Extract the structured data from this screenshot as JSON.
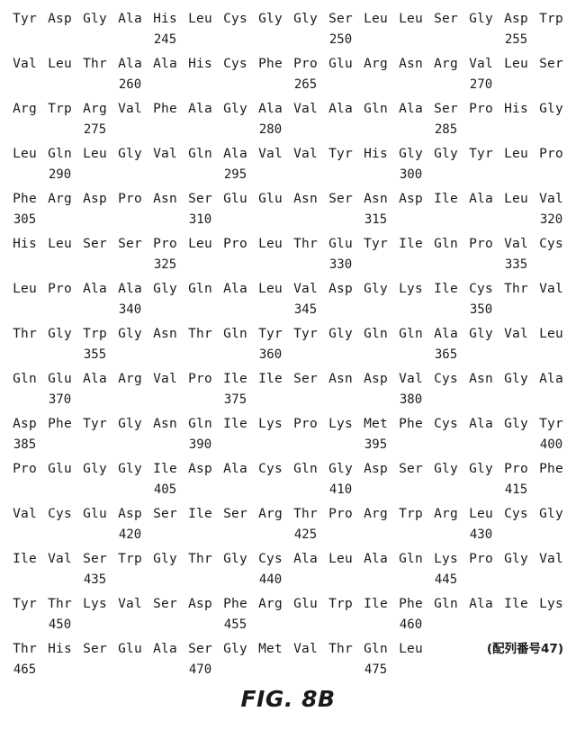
{
  "document": {
    "figure_caption": "FIG. 8B",
    "seq_id_note": "(配列番号47)"
  },
  "sequence": {
    "residues_per_row": 16,
    "rows": [
      {
        "residues": [
          "Tyr",
          "Asp",
          "Gly",
          "Ala",
          "His",
          "Leu",
          "Cys",
          "Gly",
          "Gly",
          "Ser",
          "Leu",
          "Leu",
          "Ser",
          "Gly",
          "Asp",
          "Trp"
        ],
        "numbers": [
          "",
          "",
          "",
          "",
          "245",
          "",
          "",
          "",
          "",
          "250",
          "",
          "",
          "",
          "",
          "255",
          ""
        ]
      },
      {
        "residues": [
          "Val",
          "Leu",
          "Thr",
          "Ala",
          "Ala",
          "His",
          "Cys",
          "Phe",
          "Pro",
          "Glu",
          "Arg",
          "Asn",
          "Arg",
          "Val",
          "Leu",
          "Ser"
        ],
        "numbers": [
          "",
          "",
          "",
          "260",
          "",
          "",
          "",
          "",
          "265",
          "",
          "",
          "",
          "",
          "270",
          "",
          ""
        ]
      },
      {
        "residues": [
          "Arg",
          "Trp",
          "Arg",
          "Val",
          "Phe",
          "Ala",
          "Gly",
          "Ala",
          "Val",
          "Ala",
          "Gln",
          "Ala",
          "Ser",
          "Pro",
          "His",
          "Gly"
        ],
        "numbers": [
          "",
          "",
          "275",
          "",
          "",
          "",
          "",
          "280",
          "",
          "",
          "",
          "",
          "285",
          "",
          "",
          ""
        ]
      },
      {
        "residues": [
          "Leu",
          "Gln",
          "Leu",
          "Gly",
          "Val",
          "Gln",
          "Ala",
          "Val",
          "Val",
          "Tyr",
          "His",
          "Gly",
          "Gly",
          "Tyr",
          "Leu",
          "Pro"
        ],
        "numbers": [
          "",
          "290",
          "",
          "",
          "",
          "",
          "295",
          "",
          "",
          "",
          "",
          "300",
          "",
          "",
          "",
          ""
        ]
      },
      {
        "residues": [
          "Phe",
          "Arg",
          "Asp",
          "Pro",
          "Asn",
          "Ser",
          "Glu",
          "Glu",
          "Asn",
          "Ser",
          "Asn",
          "Asp",
          "Ile",
          "Ala",
          "Leu",
          "Val"
        ],
        "numbers": [
          "305",
          "",
          "",
          "",
          "",
          "310",
          "",
          "",
          "",
          "",
          "315",
          "",
          "",
          "",
          "",
          "320"
        ]
      },
      {
        "residues": [
          "His",
          "Leu",
          "Ser",
          "Ser",
          "Pro",
          "Leu",
          "Pro",
          "Leu",
          "Thr",
          "Glu",
          "Tyr",
          "Ile",
          "Gln",
          "Pro",
          "Val",
          "Cys"
        ],
        "numbers": [
          "",
          "",
          "",
          "",
          "325",
          "",
          "",
          "",
          "",
          "330",
          "",
          "",
          "",
          "",
          "335",
          ""
        ]
      },
      {
        "residues": [
          "Leu",
          "Pro",
          "Ala",
          "Ala",
          "Gly",
          "Gln",
          "Ala",
          "Leu",
          "Val",
          "Asp",
          "Gly",
          "Lys",
          "Ile",
          "Cys",
          "Thr",
          "Val"
        ],
        "numbers": [
          "",
          "",
          "",
          "340",
          "",
          "",
          "",
          "",
          "345",
          "",
          "",
          "",
          "",
          "350",
          "",
          ""
        ]
      },
      {
        "residues": [
          "Thr",
          "Gly",
          "Trp",
          "Gly",
          "Asn",
          "Thr",
          "Gln",
          "Tyr",
          "Tyr",
          "Gly",
          "Gln",
          "Gln",
          "Ala",
          "Gly",
          "Val",
          "Leu"
        ],
        "numbers": [
          "",
          "",
          "355",
          "",
          "",
          "",
          "",
          "360",
          "",
          "",
          "",
          "",
          "365",
          "",
          "",
          ""
        ]
      },
      {
        "residues": [
          "Gln",
          "Glu",
          "Ala",
          "Arg",
          "Val",
          "Pro",
          "Ile",
          "Ile",
          "Ser",
          "Asn",
          "Asp",
          "Val",
          "Cys",
          "Asn",
          "Gly",
          "Ala"
        ],
        "numbers": [
          "",
          "370",
          "",
          "",
          "",
          "",
          "375",
          "",
          "",
          "",
          "",
          "380",
          "",
          "",
          "",
          ""
        ]
      },
      {
        "residues": [
          "Asp",
          "Phe",
          "Tyr",
          "Gly",
          "Asn",
          "Gln",
          "Ile",
          "Lys",
          "Pro",
          "Lys",
          "Met",
          "Phe",
          "Cys",
          "Ala",
          "Gly",
          "Tyr"
        ],
        "numbers": [
          "385",
          "",
          "",
          "",
          "",
          "390",
          "",
          "",
          "",
          "",
          "395",
          "",
          "",
          "",
          "",
          "400"
        ]
      },
      {
        "residues": [
          "Pro",
          "Glu",
          "Gly",
          "Gly",
          "Ile",
          "Asp",
          "Ala",
          "Cys",
          "Gln",
          "Gly",
          "Asp",
          "Ser",
          "Gly",
          "Gly",
          "Pro",
          "Phe"
        ],
        "numbers": [
          "",
          "",
          "",
          "",
          "405",
          "",
          "",
          "",
          "",
          "410",
          "",
          "",
          "",
          "",
          "415",
          ""
        ]
      },
      {
        "residues": [
          "Val",
          "Cys",
          "Glu",
          "Asp",
          "Ser",
          "Ile",
          "Ser",
          "Arg",
          "Thr",
          "Pro",
          "Arg",
          "Trp",
          "Arg",
          "Leu",
          "Cys",
          "Gly"
        ],
        "numbers": [
          "",
          "",
          "",
          "420",
          "",
          "",
          "",
          "",
          "425",
          "",
          "",
          "",
          "",
          "430",
          "",
          ""
        ]
      },
      {
        "residues": [
          "Ile",
          "Val",
          "Ser",
          "Trp",
          "Gly",
          "Thr",
          "Gly",
          "Cys",
          "Ala",
          "Leu",
          "Ala",
          "Gln",
          "Lys",
          "Pro",
          "Gly",
          "Val"
        ],
        "numbers": [
          "",
          "",
          "435",
          "",
          "",
          "",
          "",
          "440",
          "",
          "",
          "",
          "",
          "445",
          "",
          "",
          ""
        ]
      },
      {
        "residues": [
          "Tyr",
          "Thr",
          "Lys",
          "Val",
          "Ser",
          "Asp",
          "Phe",
          "Arg",
          "Glu",
          "Trp",
          "Ile",
          "Phe",
          "Gln",
          "Ala",
          "Ile",
          "Lys"
        ],
        "numbers": [
          "",
          "450",
          "",
          "",
          "",
          "",
          "455",
          "",
          "",
          "",
          "",
          "460",
          "",
          "",
          "",
          ""
        ]
      },
      {
        "residues": [
          "Thr",
          "His",
          "Ser",
          "Glu",
          "Ala",
          "Ser",
          "Gly",
          "Met",
          "Val",
          "Thr",
          "Gln",
          "Leu"
        ],
        "numbers": [
          "465",
          "",
          "",
          "",
          "",
          "470",
          "",
          "",
          "",
          "",
          "475",
          ""
        ]
      }
    ]
  }
}
